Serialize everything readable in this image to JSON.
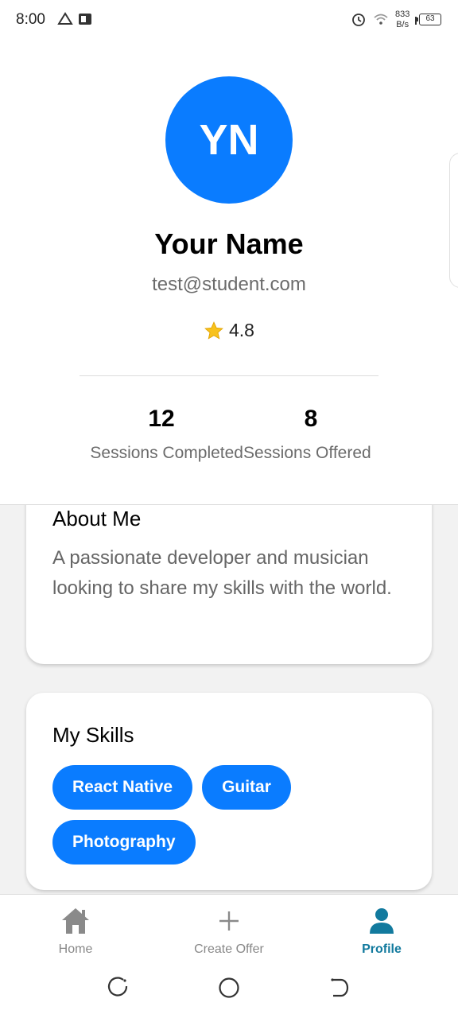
{
  "status_bar": {
    "time": "8:00",
    "net_speed_value": "833",
    "net_speed_unit": "B/s",
    "battery": "63",
    "icons": [
      "drive-icon",
      "powerpoint-icon",
      "alarm-icon",
      "wifi-icon",
      "signal-icon",
      "battery-icon"
    ]
  },
  "profile": {
    "initials": "YN",
    "name": "Your Name",
    "email": "test@student.com",
    "rating": "4.8",
    "stats": [
      {
        "value": "12",
        "label": "Sessions Completed"
      },
      {
        "value": "8",
        "label": "Sessions Offered"
      }
    ]
  },
  "about": {
    "title": "About Me",
    "text": "A passionate developer and musician looking to share my skills with the world."
  },
  "skills": {
    "title": "My Skills",
    "items": [
      "React Native",
      "Guitar",
      "Photography"
    ]
  },
  "bottom_nav": {
    "items": [
      {
        "label": "Home",
        "icon": "home-icon"
      },
      {
        "label": "Create Offer",
        "icon": "plus-icon"
      },
      {
        "label": "Profile",
        "icon": "user-icon",
        "active": true
      }
    ]
  },
  "colors": {
    "accent": "#0a7cff",
    "active_nav": "#127a9e",
    "muted_text": "#6b6b6b",
    "background": "#f2f2f2"
  }
}
